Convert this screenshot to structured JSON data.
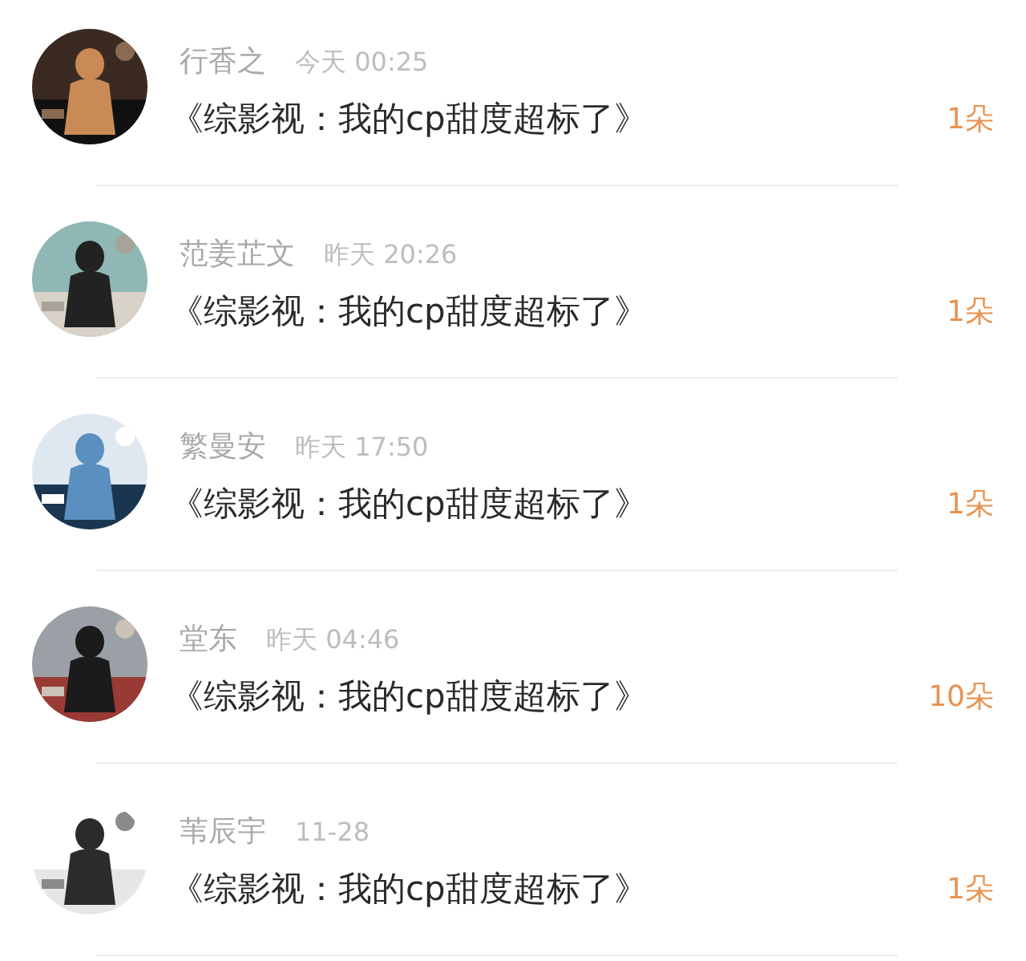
{
  "gifts": [
    {
      "name": "行香之",
      "time": "今天 00:25",
      "book": "《综影视：我的cp甜度超标了》",
      "amount": "1朵"
    },
    {
      "name": "范姜芷文",
      "time": "昨天 20:26",
      "book": "《综影视：我的cp甜度超标了》",
      "amount": "1朵"
    },
    {
      "name": "繁曼安",
      "time": "昨天 17:50",
      "book": "《综影视：我的cp甜度超标了》",
      "amount": "1朵"
    },
    {
      "name": "堂东",
      "time": "昨天 04:46",
      "book": "《综影视：我的cp甜度超标了》",
      "amount": "10朵"
    },
    {
      "name": "苇辰宇",
      "time": "11-28",
      "book": "《综影视：我的cp甜度超标了》",
      "amount": "1朵"
    }
  ]
}
